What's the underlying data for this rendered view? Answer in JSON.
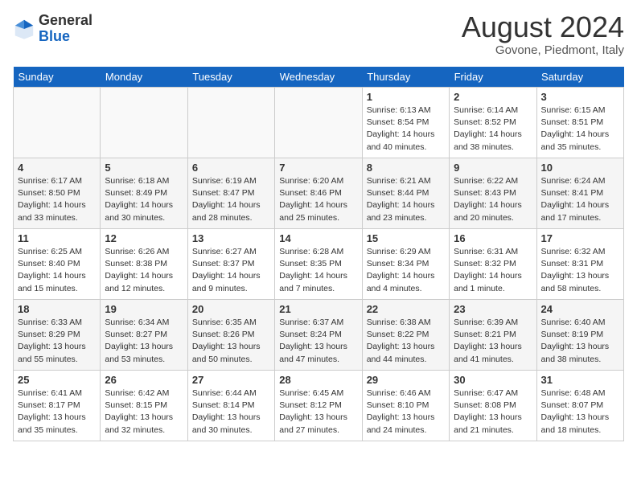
{
  "header": {
    "logo_general": "General",
    "logo_blue": "Blue",
    "month_title": "August 2024",
    "location": "Govone, Piedmont, Italy"
  },
  "weekdays": [
    "Sunday",
    "Monday",
    "Tuesday",
    "Wednesday",
    "Thursday",
    "Friday",
    "Saturday"
  ],
  "weeks": [
    [
      {
        "day": "",
        "info": ""
      },
      {
        "day": "",
        "info": ""
      },
      {
        "day": "",
        "info": ""
      },
      {
        "day": "",
        "info": ""
      },
      {
        "day": "1",
        "info": "Sunrise: 6:13 AM\nSunset: 8:54 PM\nDaylight: 14 hours\nand 40 minutes."
      },
      {
        "day": "2",
        "info": "Sunrise: 6:14 AM\nSunset: 8:52 PM\nDaylight: 14 hours\nand 38 minutes."
      },
      {
        "day": "3",
        "info": "Sunrise: 6:15 AM\nSunset: 8:51 PM\nDaylight: 14 hours\nand 35 minutes."
      }
    ],
    [
      {
        "day": "4",
        "info": "Sunrise: 6:17 AM\nSunset: 8:50 PM\nDaylight: 14 hours\nand 33 minutes."
      },
      {
        "day": "5",
        "info": "Sunrise: 6:18 AM\nSunset: 8:49 PM\nDaylight: 14 hours\nand 30 minutes."
      },
      {
        "day": "6",
        "info": "Sunrise: 6:19 AM\nSunset: 8:47 PM\nDaylight: 14 hours\nand 28 minutes."
      },
      {
        "day": "7",
        "info": "Sunrise: 6:20 AM\nSunset: 8:46 PM\nDaylight: 14 hours\nand 25 minutes."
      },
      {
        "day": "8",
        "info": "Sunrise: 6:21 AM\nSunset: 8:44 PM\nDaylight: 14 hours\nand 23 minutes."
      },
      {
        "day": "9",
        "info": "Sunrise: 6:22 AM\nSunset: 8:43 PM\nDaylight: 14 hours\nand 20 minutes."
      },
      {
        "day": "10",
        "info": "Sunrise: 6:24 AM\nSunset: 8:41 PM\nDaylight: 14 hours\nand 17 minutes."
      }
    ],
    [
      {
        "day": "11",
        "info": "Sunrise: 6:25 AM\nSunset: 8:40 PM\nDaylight: 14 hours\nand 15 minutes."
      },
      {
        "day": "12",
        "info": "Sunrise: 6:26 AM\nSunset: 8:38 PM\nDaylight: 14 hours\nand 12 minutes."
      },
      {
        "day": "13",
        "info": "Sunrise: 6:27 AM\nSunset: 8:37 PM\nDaylight: 14 hours\nand 9 minutes."
      },
      {
        "day": "14",
        "info": "Sunrise: 6:28 AM\nSunset: 8:35 PM\nDaylight: 14 hours\nand 7 minutes."
      },
      {
        "day": "15",
        "info": "Sunrise: 6:29 AM\nSunset: 8:34 PM\nDaylight: 14 hours\nand 4 minutes."
      },
      {
        "day": "16",
        "info": "Sunrise: 6:31 AM\nSunset: 8:32 PM\nDaylight: 14 hours\nand 1 minute."
      },
      {
        "day": "17",
        "info": "Sunrise: 6:32 AM\nSunset: 8:31 PM\nDaylight: 13 hours\nand 58 minutes."
      }
    ],
    [
      {
        "day": "18",
        "info": "Sunrise: 6:33 AM\nSunset: 8:29 PM\nDaylight: 13 hours\nand 55 minutes."
      },
      {
        "day": "19",
        "info": "Sunrise: 6:34 AM\nSunset: 8:27 PM\nDaylight: 13 hours\nand 53 minutes."
      },
      {
        "day": "20",
        "info": "Sunrise: 6:35 AM\nSunset: 8:26 PM\nDaylight: 13 hours\nand 50 minutes."
      },
      {
        "day": "21",
        "info": "Sunrise: 6:37 AM\nSunset: 8:24 PM\nDaylight: 13 hours\nand 47 minutes."
      },
      {
        "day": "22",
        "info": "Sunrise: 6:38 AM\nSunset: 8:22 PM\nDaylight: 13 hours\nand 44 minutes."
      },
      {
        "day": "23",
        "info": "Sunrise: 6:39 AM\nSunset: 8:21 PM\nDaylight: 13 hours\nand 41 minutes."
      },
      {
        "day": "24",
        "info": "Sunrise: 6:40 AM\nSunset: 8:19 PM\nDaylight: 13 hours\nand 38 minutes."
      }
    ],
    [
      {
        "day": "25",
        "info": "Sunrise: 6:41 AM\nSunset: 8:17 PM\nDaylight: 13 hours\nand 35 minutes."
      },
      {
        "day": "26",
        "info": "Sunrise: 6:42 AM\nSunset: 8:15 PM\nDaylight: 13 hours\nand 32 minutes."
      },
      {
        "day": "27",
        "info": "Sunrise: 6:44 AM\nSunset: 8:14 PM\nDaylight: 13 hours\nand 30 minutes."
      },
      {
        "day": "28",
        "info": "Sunrise: 6:45 AM\nSunset: 8:12 PM\nDaylight: 13 hours\nand 27 minutes."
      },
      {
        "day": "29",
        "info": "Sunrise: 6:46 AM\nSunset: 8:10 PM\nDaylight: 13 hours\nand 24 minutes."
      },
      {
        "day": "30",
        "info": "Sunrise: 6:47 AM\nSunset: 8:08 PM\nDaylight: 13 hours\nand 21 minutes."
      },
      {
        "day": "31",
        "info": "Sunrise: 6:48 AM\nSunset: 8:07 PM\nDaylight: 13 hours\nand 18 minutes."
      }
    ]
  ]
}
